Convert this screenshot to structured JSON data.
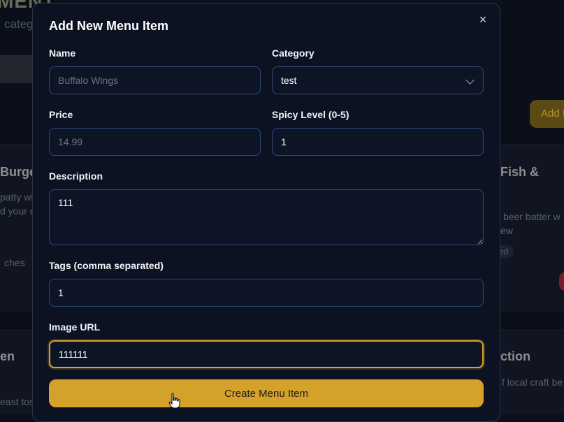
{
  "background": {
    "heading_fragment": "MENT",
    "subtitle_fragment": "categ",
    "add_button_fragment": "Add I",
    "cards": [
      {
        "title": "Burge",
        "lines": [
          "patty wi",
          "d your c"
        ],
        "footer": "ches"
      },
      {
        "title": "Fish &",
        "lines": [
          "beer batter w",
          "ew"
        ],
        "tag": "ed"
      },
      {
        "title": "en",
        "lines": [
          "east tos"
        ]
      },
      {
        "title": "ction",
        "lines": [
          "f local craft be"
        ]
      }
    ]
  },
  "modal": {
    "title": "Add New Menu Item",
    "close_glyph": "×",
    "fields": {
      "name": {
        "label": "Name",
        "placeholder": "Buffalo Wings",
        "value": ""
      },
      "category": {
        "label": "Category",
        "value": "test"
      },
      "price": {
        "label": "Price",
        "placeholder": "14.99",
        "value": ""
      },
      "spicy": {
        "label": "Spicy Level (0-5)",
        "value": "1"
      },
      "description": {
        "label": "Description",
        "value": "111"
      },
      "tags": {
        "label": "Tags (comma separated)",
        "value": "1"
      },
      "image_url": {
        "label": "Image URL",
        "value": "111111"
      }
    },
    "submit_label": "Create Menu Item"
  },
  "colors": {
    "accent": "#d4a12a",
    "modal_bg": "#0d1222",
    "field_border": "#2e4a78"
  }
}
